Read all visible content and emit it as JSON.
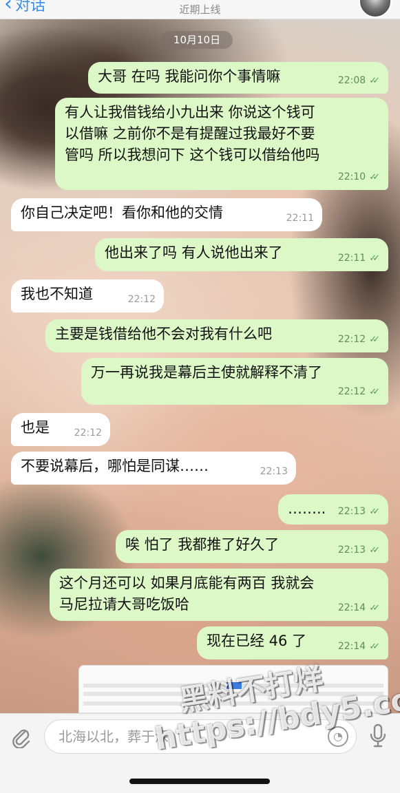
{
  "header": {
    "back_label": "对话",
    "status": "近期上线"
  },
  "chat": {
    "date": "10月10日",
    "messages": [
      {
        "dir": "out",
        "text": "大哥 在吗 我能问你个事情嘛",
        "time": "22:08",
        "read": true
      },
      {
        "dir": "out",
        "text": "有人让我借钱给小九出来 你说这个钱可\n以借嘛 之前你不是有提醒过我最好不要\n管吗 所以我想问下 这个钱可以借给他吗",
        "time": "22:10",
        "read": true
      },
      {
        "dir": "in",
        "text": "你自己决定吧！看你和他的交情",
        "time": "22:11"
      },
      {
        "dir": "out",
        "text": "他出来了吗 有人说他出来了",
        "time": "22:11",
        "read": true
      },
      {
        "dir": "in",
        "text": "我也不知道",
        "time": "22:12"
      },
      {
        "dir": "out",
        "text": "主要是钱借给他不会对我有什么吧",
        "time": "22:12",
        "read": true
      },
      {
        "dir": "out",
        "text": "万一再说我是幕后主使就解释不清了",
        "time": "22:12",
        "read": true
      },
      {
        "dir": "in",
        "text": "也是",
        "time": "22:12"
      },
      {
        "dir": "in",
        "text": "不要说幕后，哪怕是同谋……",
        "time": "22:13"
      },
      {
        "dir": "out",
        "text": "……..",
        "time": "22:13",
        "read": true
      },
      {
        "dir": "out",
        "text": "唉 怕了 我都推了好久了",
        "time": "22:13",
        "read": true
      },
      {
        "dir": "out",
        "text": "这个月还可以 如果月底能有两百 我就会\n马尼拉请大哥吃饭哈",
        "time": "22:14",
        "read": true
      },
      {
        "dir": "out",
        "text": "现在已经 46 了",
        "time": "22:14",
        "read": true
      }
    ]
  },
  "input": {
    "placeholder": "北海以北，葬于深"
  },
  "watermark": {
    "line1": "黑料不打烊",
    "line2": "https://bdy5.co"
  },
  "icons": {
    "back": "chevron-left-icon",
    "attach": "paperclip-icon",
    "sticker": "sticker-icon",
    "mic": "microphone-icon",
    "read": "double-check-icon"
  },
  "colors": {
    "outgoing_bubble": "#dcf8c6",
    "incoming_bubble": "#ffffff",
    "accent": "#3a8ee6"
  }
}
